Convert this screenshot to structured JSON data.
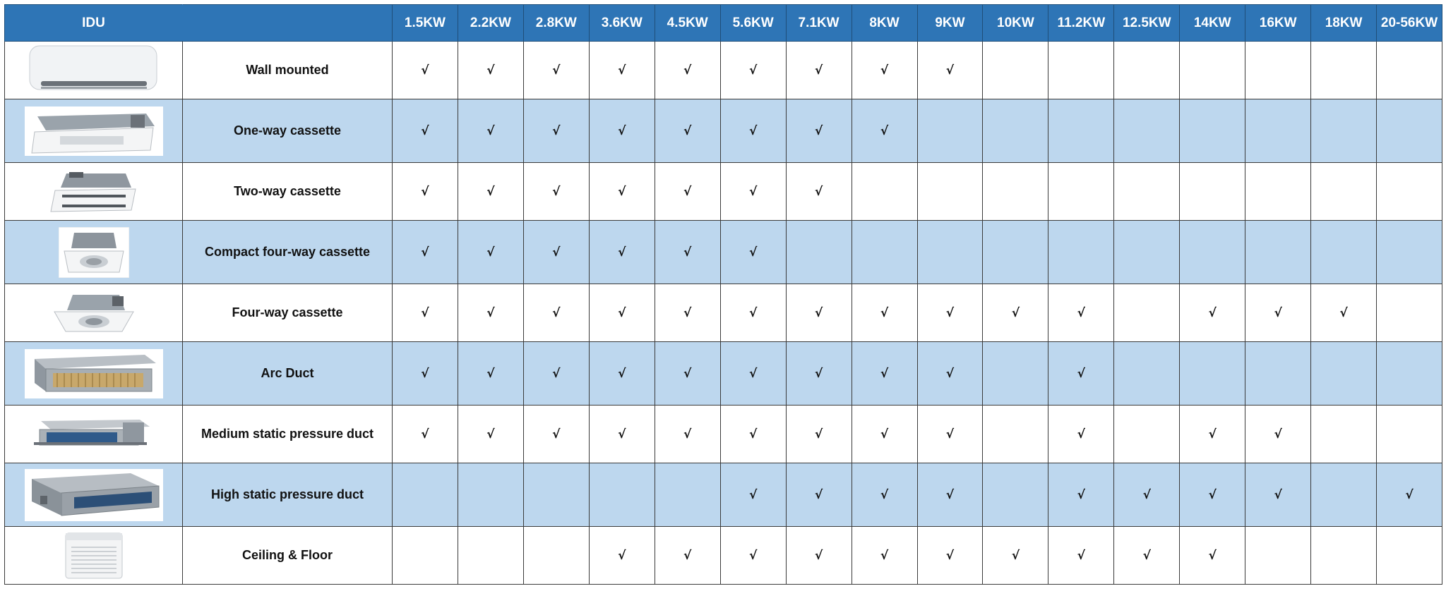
{
  "header": {
    "first": "IDU",
    "capacities": [
      "1.5KW",
      "2.2KW",
      "2.8KW",
      "3.6KW",
      "4.5KW",
      "5.6KW",
      "7.1KW",
      "8KW",
      "9KW",
      "10KW",
      "11.2KW",
      "12.5KW",
      "14KW",
      "16KW",
      "18KW",
      "20-56KW"
    ]
  },
  "tick_symbol": "√",
  "header_color": "#2e75b6",
  "stripe_color": "#bdd7ee",
  "rows": [
    {
      "name": "Wall mounted",
      "image": "wall-mounted-unit",
      "avail": [
        1,
        1,
        1,
        1,
        1,
        1,
        1,
        1,
        1,
        0,
        0,
        0,
        0,
        0,
        0,
        0
      ]
    },
    {
      "name": "One-way cassette",
      "image": "one-way-cassette-unit",
      "avail": [
        1,
        1,
        1,
        1,
        1,
        1,
        1,
        1,
        0,
        0,
        0,
        0,
        0,
        0,
        0,
        0
      ]
    },
    {
      "name": "Two-way cassette",
      "image": "two-way-cassette-unit",
      "avail": [
        1,
        1,
        1,
        1,
        1,
        1,
        1,
        0,
        0,
        0,
        0,
        0,
        0,
        0,
        0,
        0
      ]
    },
    {
      "name": "Compact four-way cassette",
      "image": "compact-four-way-cassette-unit",
      "avail": [
        1,
        1,
        1,
        1,
        1,
        1,
        0,
        0,
        0,
        0,
        0,
        0,
        0,
        0,
        0,
        0
      ]
    },
    {
      "name": "Four-way cassette",
      "image": "four-way-cassette-unit",
      "avail": [
        1,
        1,
        1,
        1,
        1,
        1,
        1,
        1,
        1,
        1,
        1,
        0,
        1,
        1,
        1,
        0
      ]
    },
    {
      "name": "Arc Duct",
      "image": "arc-duct-unit",
      "avail": [
        1,
        1,
        1,
        1,
        1,
        1,
        1,
        1,
        1,
        0,
        1,
        0,
        0,
        0,
        0,
        0
      ]
    },
    {
      "name": "Medium static pressure duct",
      "image": "medium-static-duct-unit",
      "avail": [
        1,
        1,
        1,
        1,
        1,
        1,
        1,
        1,
        1,
        0,
        1,
        0,
        1,
        1,
        0,
        0
      ]
    },
    {
      "name": "High static pressure duct",
      "image": "high-static-duct-unit",
      "avail": [
        0,
        0,
        0,
        0,
        0,
        1,
        1,
        1,
        1,
        0,
        1,
        1,
        1,
        1,
        0,
        1
      ]
    },
    {
      "name": "Ceiling  & Floor",
      "image": "ceiling-floor-unit",
      "avail": [
        0,
        0,
        0,
        1,
        1,
        1,
        1,
        1,
        1,
        1,
        1,
        1,
        1,
        0,
        0,
        0
      ]
    }
  ]
}
